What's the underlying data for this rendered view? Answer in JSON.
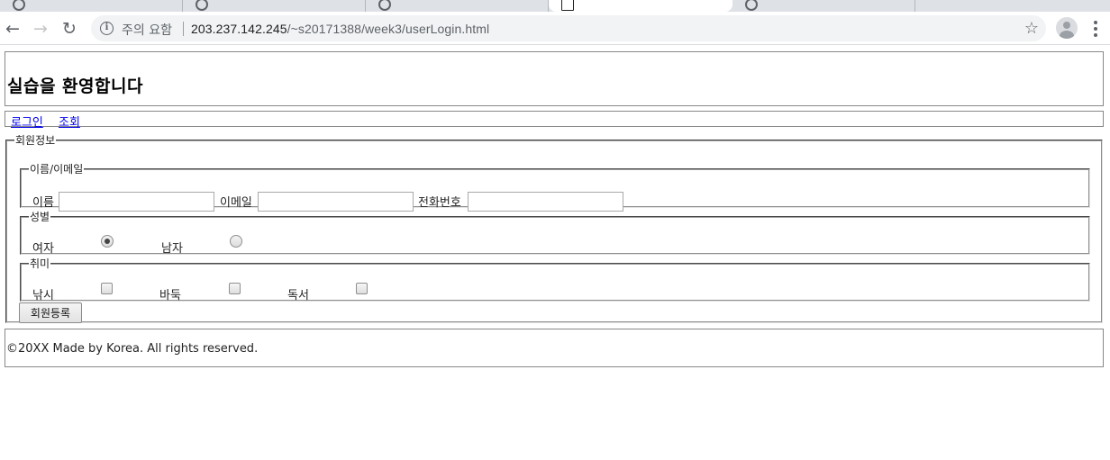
{
  "browser": {
    "security_text": "주의 요함",
    "url_host": "203.237.142.245",
    "url_path": "/~s20171388/week3/userLogin.html"
  },
  "header": {
    "title": "실습을 환영합니다"
  },
  "nav": {
    "links": [
      "로그인",
      "조회"
    ]
  },
  "form": {
    "legend": "회원정보",
    "name_section": {
      "legend": "이름/이메일",
      "name_label": "이름",
      "email_label": "이메일",
      "phone_label": "전화번호",
      "name_value": "",
      "email_value": "",
      "phone_value": ""
    },
    "gender_section": {
      "legend": "성별",
      "options": [
        {
          "label": "여자",
          "checked": true
        },
        {
          "label": "남자",
          "checked": false
        }
      ]
    },
    "hobby_section": {
      "legend": "취미",
      "options": [
        {
          "label": "낚시",
          "checked": false
        },
        {
          "label": "바둑",
          "checked": false
        },
        {
          "label": "독서",
          "checked": false
        }
      ]
    },
    "submit_label": "회원등록"
  },
  "footer": {
    "text": "©20XX Made by Korea. All rights reserved."
  }
}
